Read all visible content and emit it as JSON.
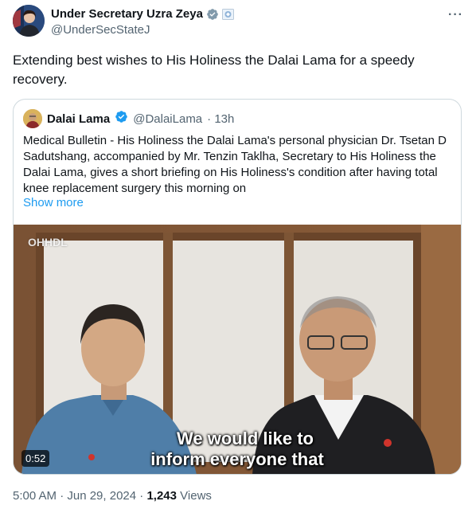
{
  "tweet": {
    "author_name": "Under Secretary Uzra Zeya",
    "author_handle": "@UnderSecStateJ",
    "more_icon": "more-horizontal-icon",
    "text": "Extending best wishes to His Holiness the Dalai Lama for a speedy recovery.",
    "timestamp": "5:00 AM · Jun 29, 2024",
    "views_count": "1,243",
    "views_label": "Views",
    "separator": "·"
  },
  "quoted": {
    "author_name": "Dalai Lama",
    "author_handle": "@DalaiLama",
    "time_ago": "· 13h",
    "text": "Medical Bulletin - His Holiness the Dalai Lama's personal physician Dr. Tsetan D Sadutshang, accompanied by Mr. Tenzin Taklha, Secretary to His Holiness the Dalai Lama, gives a short briefing on His Holiness's condition after having total knee replacement surgery this morning on",
    "show_more": "Show more",
    "video": {
      "watermark": "OHHDL",
      "caption_line1": "We would like to",
      "caption_line2": "inform everyone that",
      "duration": "0:52"
    }
  },
  "colors": {
    "accent": "#1d9bf0",
    "verified_gray": "#829aab",
    "verified_blue": "#1d9bf0",
    "secondary_text": "#536471"
  }
}
